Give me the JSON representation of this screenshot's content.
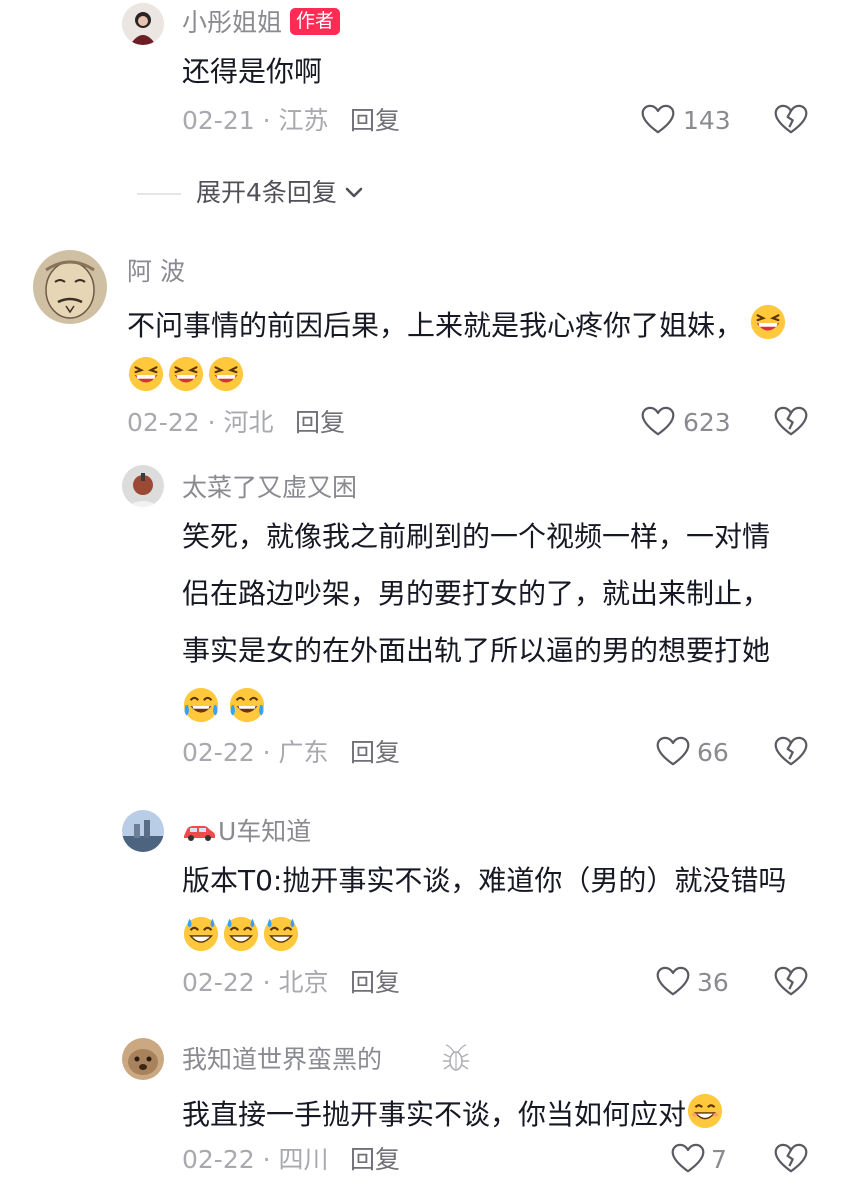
{
  "comments": [
    {
      "username": "小彤姐姐",
      "badge": "作者",
      "text": "还得是你啊",
      "date_location": "02-21 · 江苏",
      "reply_label": "回复",
      "likes": "143"
    },
    {
      "expand_label": "展开4条回复"
    },
    {
      "username": "阿 波",
      "text_line1": "不问事情的前因后果，上来就是我心疼你了姐妹，",
      "date_location": "02-22 · 河北",
      "reply_label": "回复",
      "likes": "623"
    },
    {
      "username": "太菜了又虚又困",
      "text_line1": "笑死，就像我之前刷到的一个视频一样，一对情",
      "text_line2": "侣在路边吵架，男的要打女的了，就出来制止，",
      "text_line3": "事实是女的在外面出轨了所以逼的男的想要打她",
      "date_location": "02-22 · 广东",
      "reply_label": "回复",
      "likes": "66"
    },
    {
      "username": "U车知道",
      "text_line1": "版本T0:抛开事实不谈，难道你（男的）就没错吗",
      "date_location": "02-22 · 北京",
      "reply_label": "回复",
      "likes": "36"
    },
    {
      "username": "我知道世界蛮黑的",
      "text_line1": "我直接一手抛开事实不谈，你当如何应对",
      "date_location": "02-22 · 四川",
      "reply_label": "回复",
      "likes": "7"
    }
  ],
  "icons": {
    "like": "heart-outline-icon",
    "dislike": "broken-heart-icon",
    "expand": "chevron-down-icon",
    "car": "car-icon",
    "bug": "cockroach-icon",
    "emoji_grin": "laughing-emoji",
    "emoji_tears": "tears-of-joy-emoji",
    "emoji_sweat": "sweat-smile-emoji",
    "emoji_smile": "smile-emoji"
  },
  "colors": {
    "badge_bg": "#fe2c55",
    "text": "#161823",
    "secondary": "#8a8b91",
    "emoji_face": "#ffc83d"
  }
}
